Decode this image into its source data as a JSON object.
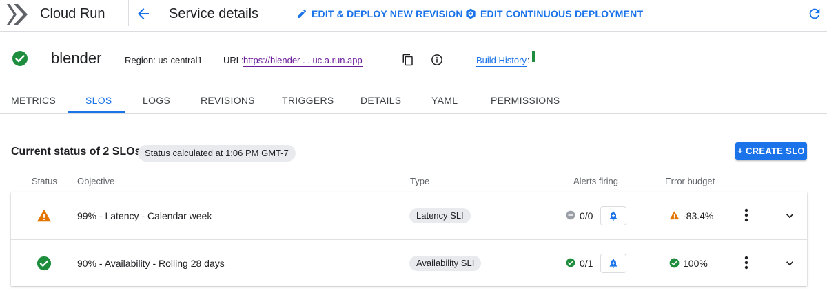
{
  "header": {
    "app_title": "Cloud Run",
    "page_title": "Service details",
    "edit_deploy_label": "EDIT & DEPLOY NEW REVISION",
    "edit_cd_label": "EDIT CONTINUOUS DEPLOYMENT"
  },
  "service": {
    "name": "blender",
    "region": "Region: us-central1",
    "url_label": "URL:",
    "url": "https://blender        .    .    uc.a.run.app",
    "build_history": "Build History",
    "build_sep": ":"
  },
  "tabs": [
    {
      "label": "METRICS"
    },
    {
      "label": "SLOS"
    },
    {
      "label": "LOGS"
    },
    {
      "label": "REVISIONS"
    },
    {
      "label": "TRIGGERS"
    },
    {
      "label": "DETAILS"
    },
    {
      "label": "YAML"
    },
    {
      "label": "PERMISSIONS"
    }
  ],
  "active_tab": "SLOS",
  "slo": {
    "title": "Current status of 2 SLOs",
    "status_chip": "Status calculated at 1:06 PM GMT-7",
    "create_label": "+ CREATE SLO",
    "columns": {
      "status": "Status",
      "objective": "Objective",
      "type": "Type",
      "alerts": "Alerts firing",
      "budget": "Error budget"
    },
    "rows": [
      {
        "status": "warning",
        "objective": "99% - Latency - Calendar week",
        "type": "Latency SLI",
        "alerts_state": "none",
        "alerts": "0/0",
        "budget_state": "warning",
        "budget": "-83.4%"
      },
      {
        "status": "ok",
        "objective": "90% - Availability - Rolling 28 days",
        "type": "Availability SLI",
        "alerts_state": "ok",
        "alerts": "0/1",
        "budget_state": "ok",
        "budget": "100%"
      }
    ]
  },
  "colors": {
    "accent": "#1a73e8",
    "ok": "#1e8e3e",
    "warning": "#e37400",
    "neutral": "#9aa0a6",
    "link_visited": "#6a1b9a"
  },
  "icons": {
    "logo": "cloud-run-logo",
    "back": "arrow-back-icon",
    "edit": "pencil-icon",
    "cd": "cloud-build-icon",
    "refresh": "refresh-icon",
    "copy": "copy-icon",
    "info": "info-icon",
    "bell": "bell-icon",
    "more": "more-vert-icon",
    "expand": "chevron-down-icon"
  }
}
